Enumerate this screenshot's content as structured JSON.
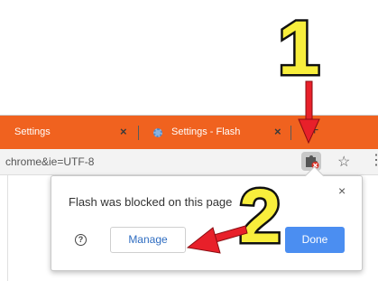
{
  "tabs": [
    {
      "title": "Settings",
      "close": "×"
    },
    {
      "title": "Settings - Flash",
      "close": "×"
    }
  ],
  "new_tab_symbol": "+",
  "omnibox": {
    "url": "chrome&ie=UTF-8"
  },
  "toolbar": {
    "star": "☆",
    "menu": "⋮"
  },
  "popup": {
    "message": "Flash was blocked on this page",
    "close": "×",
    "help": "?",
    "manage_label": "Manage",
    "done_label": "Done"
  },
  "annotations": {
    "step1": "1",
    "step2": "2"
  },
  "colors": {
    "tab_strip": "#f0621f",
    "annotation_fill": "#f8ee3c",
    "arrow": "#e8202a",
    "done_button": "#4b8ef1"
  }
}
